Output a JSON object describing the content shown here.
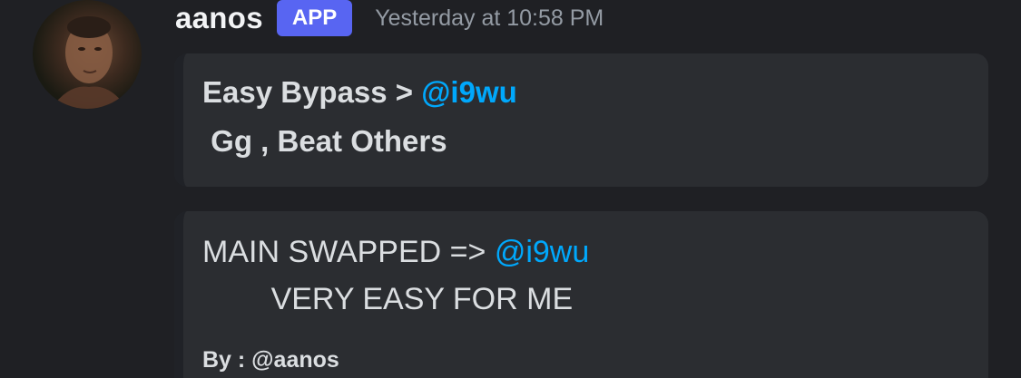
{
  "message": {
    "username": "aanos",
    "badge": "APP",
    "timestamp": "Yesterday at 10:58 PM"
  },
  "embeds": [
    {
      "line1_text": "Easy Bypass > ",
      "line1_mention": "@i9wu",
      "line2_text": " Gg , Beat Others"
    },
    {
      "line1_text": "MAIN SWAPPED => ",
      "line1_mention": "@i9wu",
      "line2_text": "        VERY EASY FOR ME",
      "footer": "By : @aanos"
    }
  ],
  "colors": {
    "background": "#1f2024",
    "embed_background": "#2b2d31",
    "badge": "#5865f2",
    "mention": "#00a8fc",
    "timestamp": "#949ba4"
  }
}
